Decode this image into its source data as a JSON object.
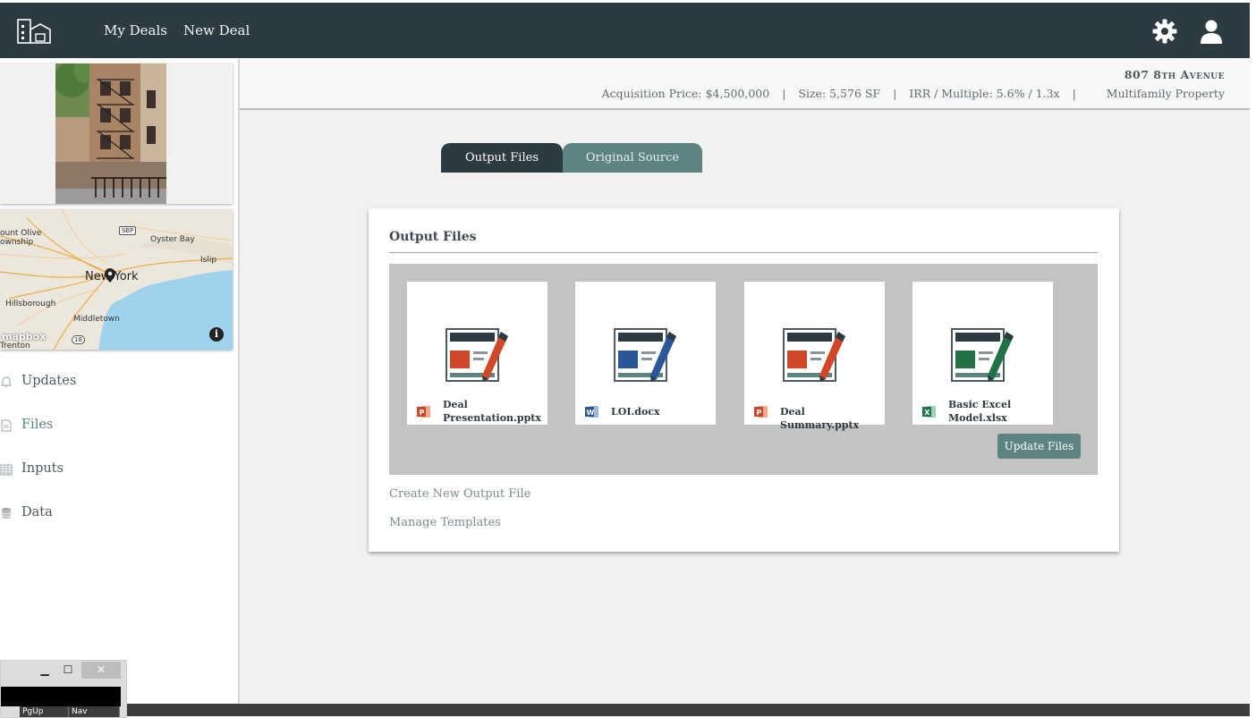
{
  "nav": {
    "my_deals": "My Deals",
    "new_deal": "New Deal",
    "logo_icon": "buildings-logo-icon",
    "settings_icon": "gear-icon",
    "account_icon": "user-icon"
  },
  "property": {
    "name": "807 8th Avenue",
    "acquisition_price": "Acquisition Price: $4,500,000",
    "size": "Size: 5,576 SF",
    "irr_multiple": "IRR / Multiple: 5.6% / 1.3x",
    "type": "Multifamily Property",
    "separator": "|"
  },
  "map": {
    "labels": [
      "ount Olive",
      "ownship",
      "Oyster Bay",
      "Islip",
      "Hillsborough",
      "Middletown",
      "Trenton",
      "SBP",
      "18"
    ],
    "city": "New York",
    "attribution": "mapbox",
    "info": "i"
  },
  "sidebar": {
    "items": [
      {
        "label": "Updates",
        "icon": "bell-icon"
      },
      {
        "label": "Files",
        "icon": "file-icon"
      },
      {
        "label": "Inputs",
        "icon": "calculator-icon"
      },
      {
        "label": "Data",
        "icon": "database-icon"
      }
    ],
    "active": "Files"
  },
  "tabs": {
    "output": "Output Files",
    "source": "Original Source"
  },
  "card": {
    "title": "Output Files",
    "files": [
      {
        "name": "Deal Presentation.pptx",
        "line1": "Deal",
        "line2": "Presentation.pptx",
        "type": "powerpoint",
        "accent": "#d04727"
      },
      {
        "name": "LOI.docx",
        "line1": "LOI.docx",
        "line2": "",
        "type": "word",
        "accent": "#2b579a"
      },
      {
        "name": "Deal Summary.pptx",
        "line1": "Deal Summary.pptx",
        "line2": "",
        "type": "powerpoint",
        "accent": "#d04727"
      },
      {
        "name": "Basic Excel Model.xlsx",
        "line1": "Basic Excel",
        "line2": "Model.xlsx",
        "type": "excel",
        "accent": "#217346"
      }
    ],
    "update_button": "Update Files",
    "create_link": "Create New Output File",
    "templates_link": "Manage Templates"
  },
  "mini_window": {
    "minimize": "▁",
    "maximize": "☐",
    "close": "✕",
    "keys": [
      "PgUp",
      "Nav"
    ]
  },
  "colors": {
    "nav_bg": "#2c3a41",
    "accent_teal": "#5d8482",
    "powerpoint": "#d04727",
    "word": "#2b579a",
    "excel": "#217346"
  }
}
